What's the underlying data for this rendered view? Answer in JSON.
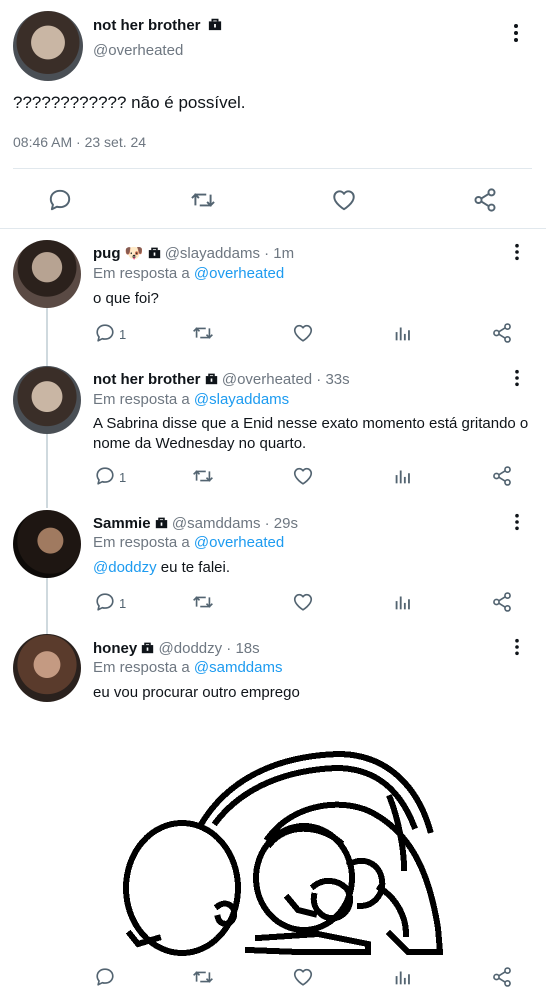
{
  "main_tweet": {
    "display_name": "not her brother",
    "handle": "@overheated",
    "text": "???????????? não é possível.",
    "meta": "08:46 AM · 23 set. 24"
  },
  "replies": [
    {
      "display_name": "pug",
      "emoji": "🐶",
      "handle_time": "@slayaddams · 1m",
      "reply_prefix": "Em resposta a",
      "reply_to": "@overheated",
      "text": "o que foi?",
      "reply_count": "1"
    },
    {
      "display_name": "not her brother",
      "handle_time": "@overheated · 33s",
      "reply_prefix": "Em resposta a",
      "reply_to": "@slayaddams",
      "text_line1": "A Sabrina disse que a Enid nesse exato momento está gritando o",
      "text_line2": "nome da Wednesday no quarto.",
      "reply_count": "1"
    },
    {
      "display_name": "Sammie",
      "handle_time": "@samddams · 29s",
      "reply_prefix": "Em resposta a",
      "reply_to": "@overheated",
      "mention": "@doddzy",
      "text_rest": " eu te falei.",
      "reply_count": "1"
    },
    {
      "display_name": "honey",
      "handle_time": "@doddzy · 18s",
      "reply_prefix": "Em resposta a",
      "reply_to": "@samddams",
      "text": "eu vou procurar outro emprego"
    }
  ],
  "icons": {
    "more": "more-dots-icon",
    "lock": "lock-icon",
    "reply": "reply-bubble-icon",
    "retweet": "retweet-icon",
    "like": "heart-icon",
    "views": "views-bar-icon",
    "share": "share-icon"
  },
  "colors": {
    "link": "#1d9bf0",
    "muted": "#6e7781",
    "divider": "#e1e8ed"
  }
}
